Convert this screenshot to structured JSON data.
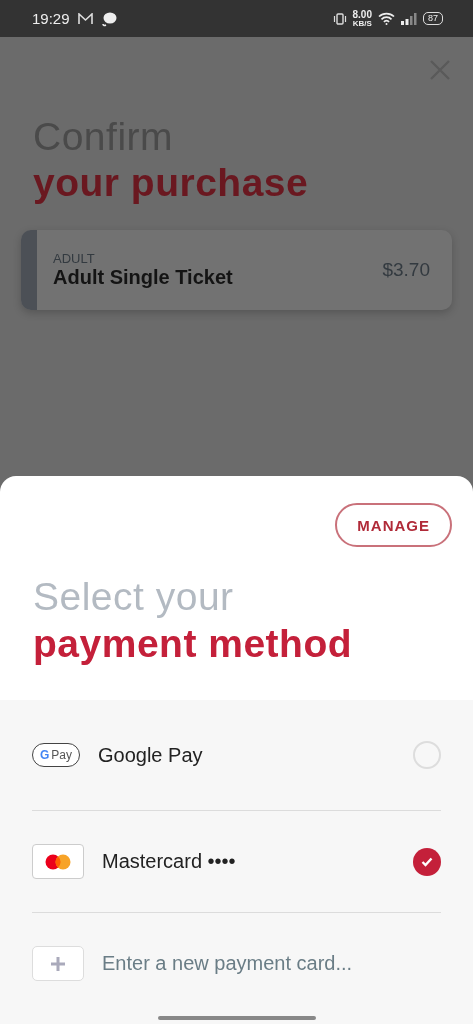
{
  "status_bar": {
    "time": "19:29",
    "speed": "8.00",
    "speed_unit": "KB/S",
    "battery": "87"
  },
  "purchase": {
    "title_line1": "Confirm",
    "title_line2": "your purchase",
    "items": [
      {
        "category": "ADULT",
        "name": "Adult Single Ticket",
        "price": "$3.70"
      }
    ]
  },
  "payment_sheet": {
    "manage_button": "MANAGE",
    "title_line1": "Select your",
    "title_line2": "payment method",
    "methods": [
      {
        "kind": "gpay",
        "logo": "Pay",
        "logo_mark": "G",
        "label": "Google Pay",
        "selected": false
      },
      {
        "kind": "mastercard",
        "label": "Mastercard",
        "masked": "••••",
        "selected": true
      },
      {
        "kind": "add",
        "placeholder": "Enter a new payment card..."
      }
    ]
  }
}
